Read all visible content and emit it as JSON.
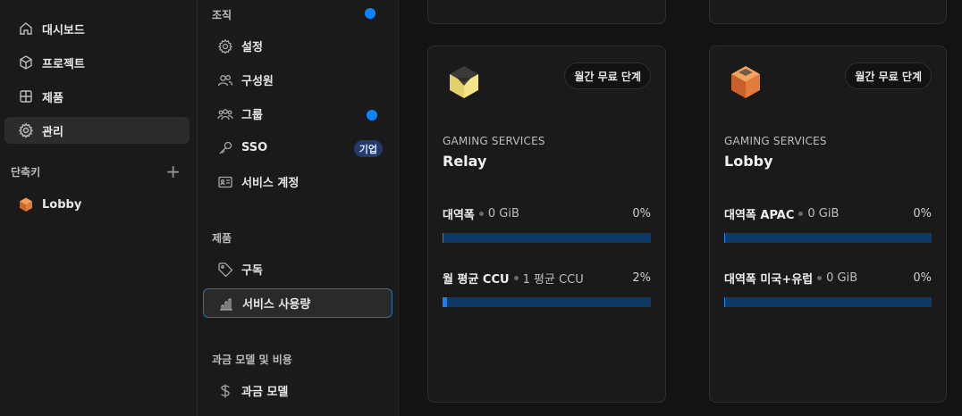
{
  "left_nav": {
    "items": [
      {
        "label": "대시보드",
        "icon": "home-icon"
      },
      {
        "label": "프로젝트",
        "icon": "cube-icon"
      },
      {
        "label": "제품",
        "icon": "grid-icon"
      },
      {
        "label": "관리",
        "icon": "gear-icon",
        "active": true
      }
    ],
    "shortcuts_label": "단축키",
    "shortcut_item": "Lobby"
  },
  "mid_nav": {
    "org_label": "조직",
    "org_items": [
      "설정",
      "구성원",
      "그룹",
      "SSO",
      "서비스 계정"
    ],
    "sso_badge": "기업",
    "products_label": "제품",
    "product_items": [
      "구독",
      "서비스 사용량"
    ],
    "billing_label": "과금 모델 및 비용",
    "billing_items": [
      "과금 모델"
    ]
  },
  "colors": {
    "accent": "#0a84ff",
    "bar_track": "#0d3a66",
    "badge_bg": "#233a6b"
  },
  "cards": [
    {
      "pill": "월간 무료 단계",
      "category": "GAMING SERVICES",
      "name": "Relay",
      "metrics": [
        {
          "label": "대역폭",
          "value": "0 GiB",
          "pct": "0%",
          "fill": 0.0
        },
        {
          "label": "월 평균 CCU",
          "value": "1 평균 CCU",
          "pct": "2%",
          "fill": 0.02
        }
      ]
    },
    {
      "pill": "월간 무료 단계",
      "category": "GAMING SERVICES",
      "name": "Lobby",
      "metrics": [
        {
          "label": "대역폭 APAC",
          "value": "0 GiB",
          "pct": "0%",
          "fill": 0.0
        },
        {
          "label": "대역폭 미국+유럽",
          "value": "0 GiB",
          "pct": "0%",
          "fill": 0.0
        }
      ]
    }
  ]
}
